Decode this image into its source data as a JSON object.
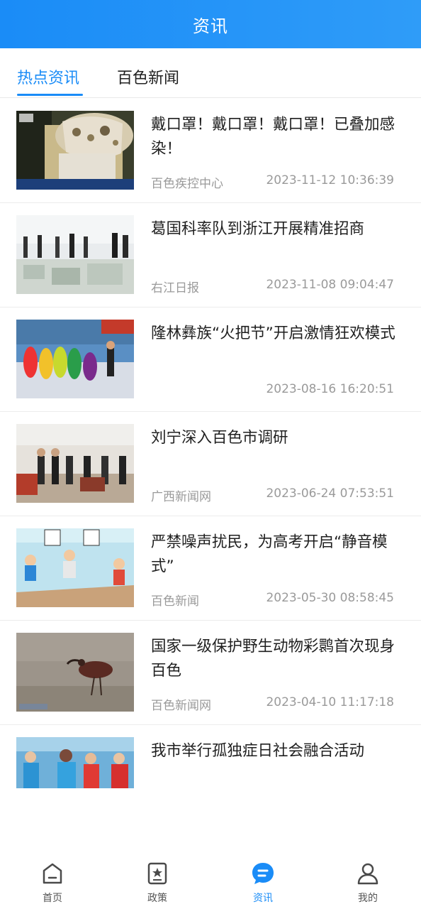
{
  "header": {
    "title": "资讯"
  },
  "tabs": [
    {
      "label": "热点资讯",
      "active": true
    },
    {
      "label": "百色新闻",
      "active": false
    }
  ],
  "news": [
    {
      "title": "戴口罩！戴口罩！戴口罩！已叠加感染！",
      "source": "百色疾控中心",
      "time": "2023-11-12 10:36:39",
      "thumb": "mask-cctv-photo"
    },
    {
      "title": "葛国科率队到浙江开展精准招商",
      "source": "右江日报",
      "time": "2023-11-08 09:04:47",
      "thumb": "model-visit-photo"
    },
    {
      "title": "隆林彝族“火把节”开启激情狂欢模式",
      "source": "",
      "time": "2023-08-16 16:20:51",
      "thumb": "festival-dance-photo"
    },
    {
      "title": "刘宁深入百色市调研",
      "source": "广西新闻网",
      "time": "2023-06-24 07:53:51",
      "thumb": "officials-visit-photo"
    },
    {
      "title": "严禁噪声扰民，为高考开启“静音模式”",
      "source": "百色新闻",
      "time": "2023-05-30 08:58:45",
      "thumb": "exam-cartoon-illustration"
    },
    {
      "title": "国家一级保护野生动物彩鹮首次现身百色",
      "source": "百色新闻网",
      "time": "2023-04-10 11:17:18",
      "thumb": "ibis-bird-photo"
    },
    {
      "title": "我市举行孤独症日社会融合活动",
      "source": "",
      "time": "",
      "thumb": "autism-day-event-photo"
    }
  ],
  "bottom_nav": [
    {
      "label": "首页",
      "icon": "home-icon",
      "active": false
    },
    {
      "label": "政策",
      "icon": "policy-icon",
      "active": false
    },
    {
      "label": "资讯",
      "icon": "news-chat-icon",
      "active": true
    },
    {
      "label": "我的",
      "icon": "user-icon",
      "active": false
    }
  ],
  "colors": {
    "primary": "#1a8cf7",
    "text": "#1f1f1f",
    "muted": "#9a9a9a"
  }
}
